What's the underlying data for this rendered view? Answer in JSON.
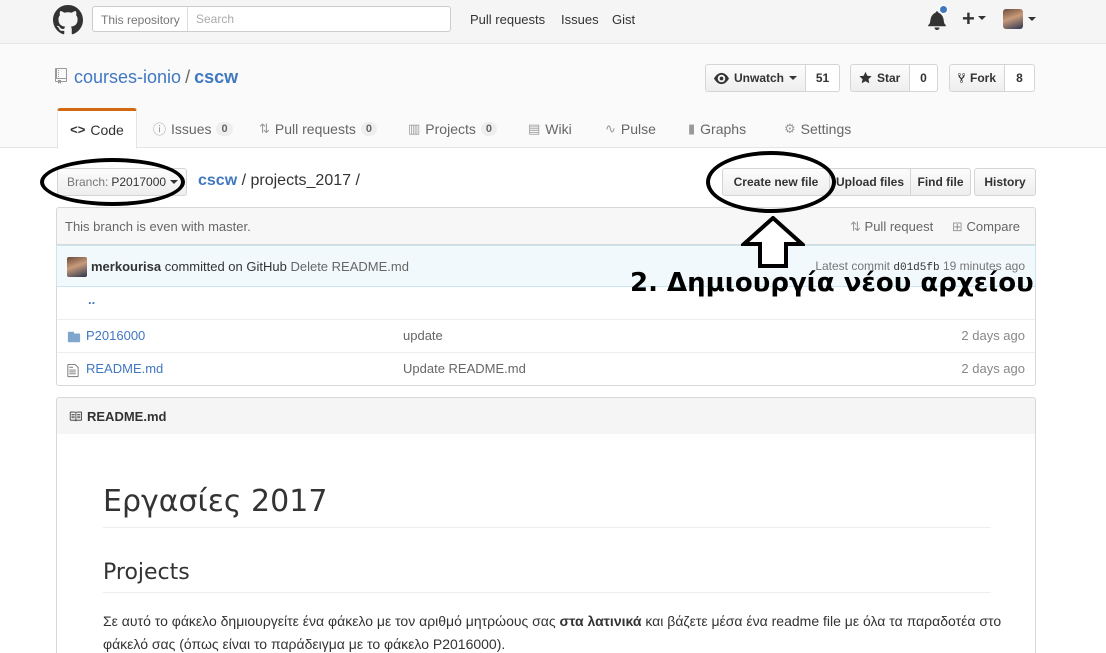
{
  "header": {
    "scope_label": "This repository",
    "search_placeholder": "Search",
    "nav": [
      "Pull requests",
      "Issues",
      "Gist"
    ]
  },
  "repo": {
    "owner": "courses-ionio",
    "separator": "/",
    "name": "cscw",
    "watch_label": "Unwatch",
    "watch_count": "51",
    "star_label": "Star",
    "star_count": "0",
    "fork_label": "Fork",
    "fork_count": "8"
  },
  "tabs": [
    {
      "label": "Code",
      "icon": "code-icon"
    },
    {
      "label": "Issues",
      "count": "0",
      "icon": "issue-icon"
    },
    {
      "label": "Pull requests",
      "count": "0",
      "icon": "pull-request-icon"
    },
    {
      "label": "Projects",
      "count": "0",
      "icon": "project-icon"
    },
    {
      "label": "Wiki",
      "icon": "book-icon"
    },
    {
      "label": "Pulse",
      "icon": "pulse-icon"
    },
    {
      "label": "Graphs",
      "icon": "graph-icon"
    },
    {
      "label": "Settings",
      "icon": "gear-icon"
    }
  ],
  "filenav": {
    "branch_label": "Branch:",
    "branch_name": "P2017000",
    "breadcrumb_root": "cscw",
    "breadcrumb_path": "projects_2017",
    "breadcrumb_sep": "/",
    "create_label": "Create new file",
    "upload_label": "Upload files",
    "find_label": "Find file",
    "history_label": "History"
  },
  "branch_info": {
    "message": "This branch is even with master.",
    "pull_request": "Pull request",
    "compare": "Compare"
  },
  "commit": {
    "author": "merkourisa",
    "action": "committed on GitHub",
    "message": "Delete README.md",
    "latest_label": "Latest commit",
    "sha": "d01d5fb",
    "age": "19 minutes ago"
  },
  "files": {
    "parent": "..",
    "rows": [
      {
        "name": "P2016000",
        "type": "folder",
        "message": "update",
        "age": "2 days ago"
      },
      {
        "name": "README.md",
        "type": "file",
        "message": "Update README.md",
        "age": "2 days ago"
      }
    ]
  },
  "readme": {
    "title": "README.md",
    "h1": "Εργασίες 2017",
    "h2": "Projects",
    "p_before": "Σε αυτό το φάκελο δημιουργείτε ένα φάκελο με τον αριθμό μητρώους σας ",
    "p_bold": "στα λατινικά",
    "p_after": " και βάζετε μέσα ένα readme file με όλα τα παραδοτέα στο φάκελό σας (όπως είναι το παράδειγμα με το φάκελο P2016000)."
  },
  "annotation": {
    "text": "2. Δημιουργία νέου αρχείου"
  },
  "colors": {
    "link": "#4078c0",
    "tab_accent": "#d26911",
    "commit_bg": "#f2f9fc",
    "notification": "#4078c0"
  }
}
